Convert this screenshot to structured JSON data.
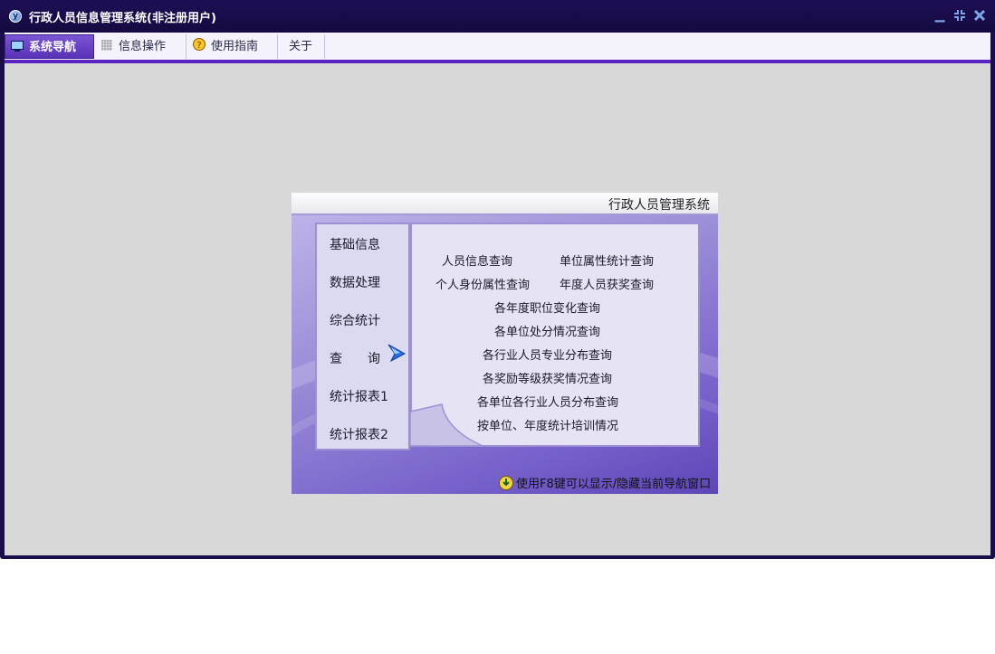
{
  "window": {
    "title": "行政人员信息管理系统(非注册用户)",
    "app_icon_letter": "y"
  },
  "menu": [
    {
      "label": "系统导航",
      "icon": "monitor-icon",
      "active": true
    },
    {
      "label": "信息操作",
      "icon": "grid-icon",
      "active": false
    },
    {
      "label": "使用指南",
      "icon": "help-icon",
      "active": false
    },
    {
      "label": "关于",
      "icon": "",
      "active": false
    }
  ],
  "panel": {
    "title": "行政人员管理系统",
    "nav": [
      "基础信息",
      "数据处理",
      "综合统计",
      "查　　询",
      "统计报表1",
      "统计报表2"
    ],
    "links": {
      "person_info": "人员信息查询",
      "unit_attr": "单位属性统计查询",
      "identity_attr": "个人身份属性查询",
      "yearly_award": "年度人员获奖查询",
      "position_change": "各年度职位变化查询",
      "unit_discipline": "各单位处分情况查询",
      "industry_major": "各行业人员专业分布查询",
      "award_level": "各奖励等级获奖情况查询",
      "unit_industry": "各单位各行业人员分布查询",
      "training_stats": "按单位、年度统计培训情况"
    },
    "footer": "使用F8键可以显示/隐藏当前导航窗口"
  },
  "colors": {
    "titlebar": "#1a0d4a",
    "accent": "#5a24c2",
    "content_bg": "#d8d8d8"
  }
}
